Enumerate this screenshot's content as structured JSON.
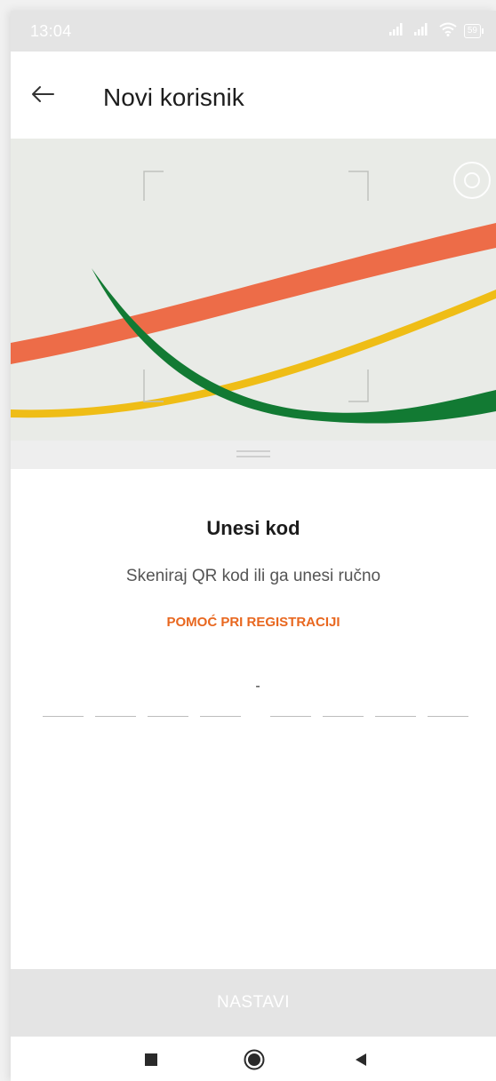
{
  "status_bar": {
    "time": "13:04",
    "battery": "59",
    "icons": [
      "signal-icon",
      "signal-icon",
      "wifi-icon",
      "battery-icon"
    ]
  },
  "header": {
    "back_icon": "arrow-left-icon",
    "title": "Novi korisnik"
  },
  "scanner": {
    "settings_icon": "camera-settings-icon",
    "stripe_colors": {
      "orange": "#ed6c48",
      "yellow": "#efbd16",
      "green": "#127a33"
    }
  },
  "code_entry": {
    "title": "Unesi kod",
    "subtitle": "Skeniraj QR kod ili ga unesi ručno",
    "help_link": "POMOĆ PRI REGISTRACIJI",
    "separator": "-",
    "slot_count": 8,
    "values": [
      "",
      "",
      "",
      "",
      "",
      "",
      "",
      ""
    ]
  },
  "footer": {
    "continue_label": "NASTAVI"
  },
  "nav_bar": {
    "icons": [
      "recents-square-icon",
      "home-circle-icon",
      "back-triangle-icon"
    ]
  },
  "colors": {
    "accent": "#e8671f",
    "disabled_button_bg": "#e4e4e4",
    "disabled_button_text": "#ffffff"
  }
}
